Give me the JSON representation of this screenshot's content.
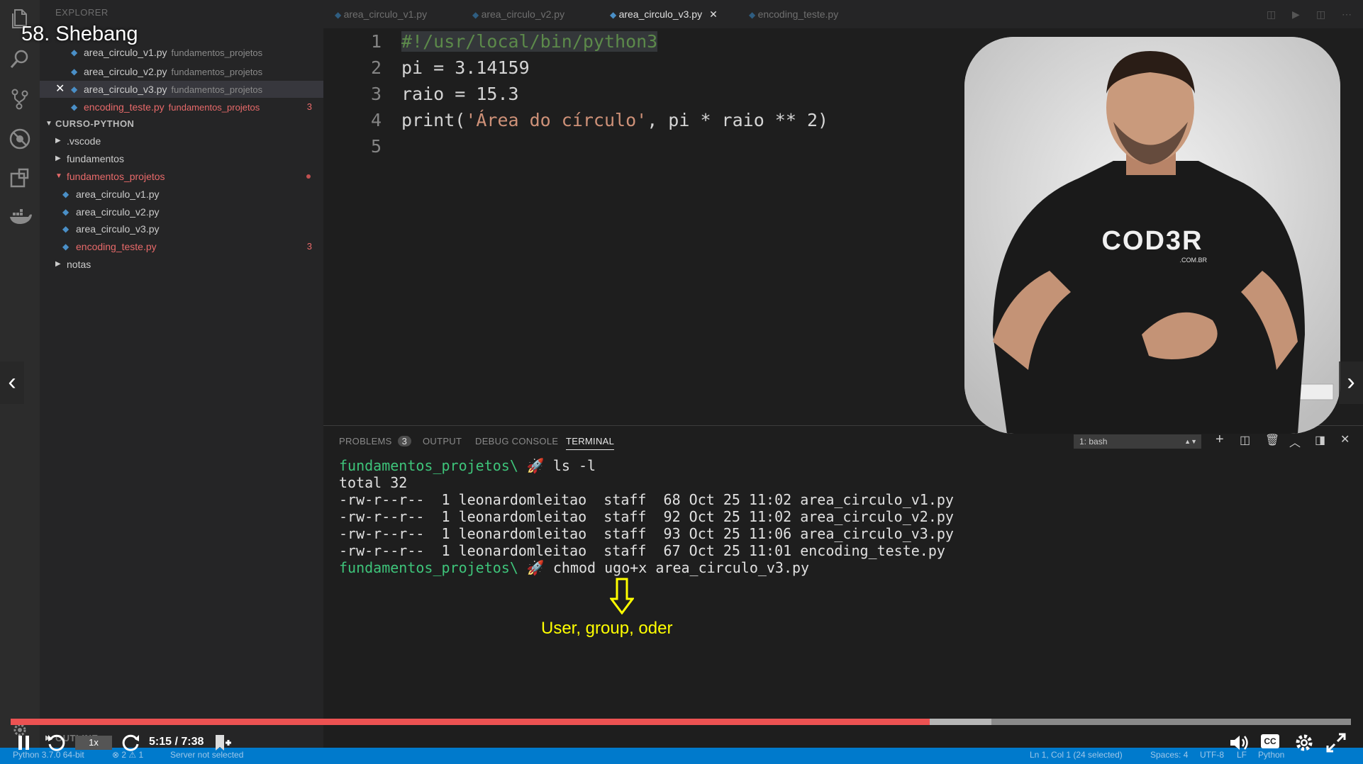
{
  "lecture_title": "58. Shebang",
  "sidebar": {
    "header": "EXPLORER",
    "open_editors": [
      {
        "name": "area_circulo_v1.py",
        "folder": "fundamentos_projetos"
      },
      {
        "name": "area_circulo_v2.py",
        "folder": "fundamentos_projetos"
      },
      {
        "name": "area_circulo_v3.py",
        "folder": "fundamentos_projetos"
      },
      {
        "name": "encoding_teste.py",
        "folder": "fundamentos_projetos",
        "badge": "3"
      }
    ],
    "project_header": "CURSO-PYTHON",
    "tree": {
      "vscode": ".vscode",
      "fundamentos": "fundamentos",
      "fundamentos_projetos": "fundamentos_projetos",
      "files": [
        {
          "name": "area_circulo_v1.py"
        },
        {
          "name": "area_circulo_v2.py"
        },
        {
          "name": "area_circulo_v3.py"
        },
        {
          "name": "encoding_teste.py",
          "badge": "3"
        }
      ],
      "notas": "notas"
    },
    "outline": "OUTLINE"
  },
  "tabs": [
    {
      "label": "area_circulo_v1.py"
    },
    {
      "label": "area_circulo_v2.py"
    },
    {
      "label": "area_circulo_v3.py",
      "active": true
    },
    {
      "label": "encoding_teste.py"
    }
  ],
  "editor": {
    "line_numbers": [
      "1",
      "2",
      "3",
      "4",
      "5"
    ],
    "line1": "#!/usr/local/bin/python3",
    "line2": "pi = 3.14159",
    "line3": "raio = 15.3",
    "line4_a": "print(",
    "line4_str": "'Área do círculo'",
    "line4_b": ", pi * raio ** 2)"
  },
  "panel": {
    "problems": "PROBLEMS",
    "problems_count": "3",
    "output": "OUTPUT",
    "debug_console": "DEBUG CONSOLE",
    "terminal": "TERMINAL",
    "shell_select": "1: bash",
    "prompt": "fundamentos_projetos\\",
    "cmd1": " ls -l",
    "total": "total 32",
    "ls_rows": [
      "-rw-r--r--  1 leonardomleitao  staff  68 Oct 25 11:02 area_circulo_v1.py",
      "-rw-r--r--  1 leonardomleitao  staff  92 Oct 25 11:02 area_circulo_v2.py",
      "-rw-r--r--  1 leonardomleitao  staff  93 Oct 25 11:06 area_circulo_v3.py",
      "-rw-r--r--  1 leonardomleitao  staff  67 Oct 25 11:01 encoding_teste.py"
    ],
    "cmd2": " chmod ugo+x area_circulo_v3.py",
    "annotation": "User, group, oder"
  },
  "video": {
    "shirt_logo": "COD3R",
    "shirt_sub": ".COM.BR"
  },
  "player": {
    "speed": "1x",
    "time": "5:15 / 7:38",
    "progress_fraction": 0.6855,
    "buffer_fraction": 0.7316,
    "cc": "CC"
  },
  "statusbar": {
    "python": "Python 3.7.0 64-bit",
    "problems": "⊗ 2 ⚠ 1",
    "server": "Server not selected",
    "position": "Ln 1, Col 1 (24 selected)",
    "spaces": "Spaces: 4",
    "encoding": "UTF-8",
    "eol": "LF",
    "language": "Python"
  },
  "colors": {
    "progress": "#ec5252",
    "terminal_prompt": "#3ec47a",
    "annotation": "#ffff00"
  }
}
